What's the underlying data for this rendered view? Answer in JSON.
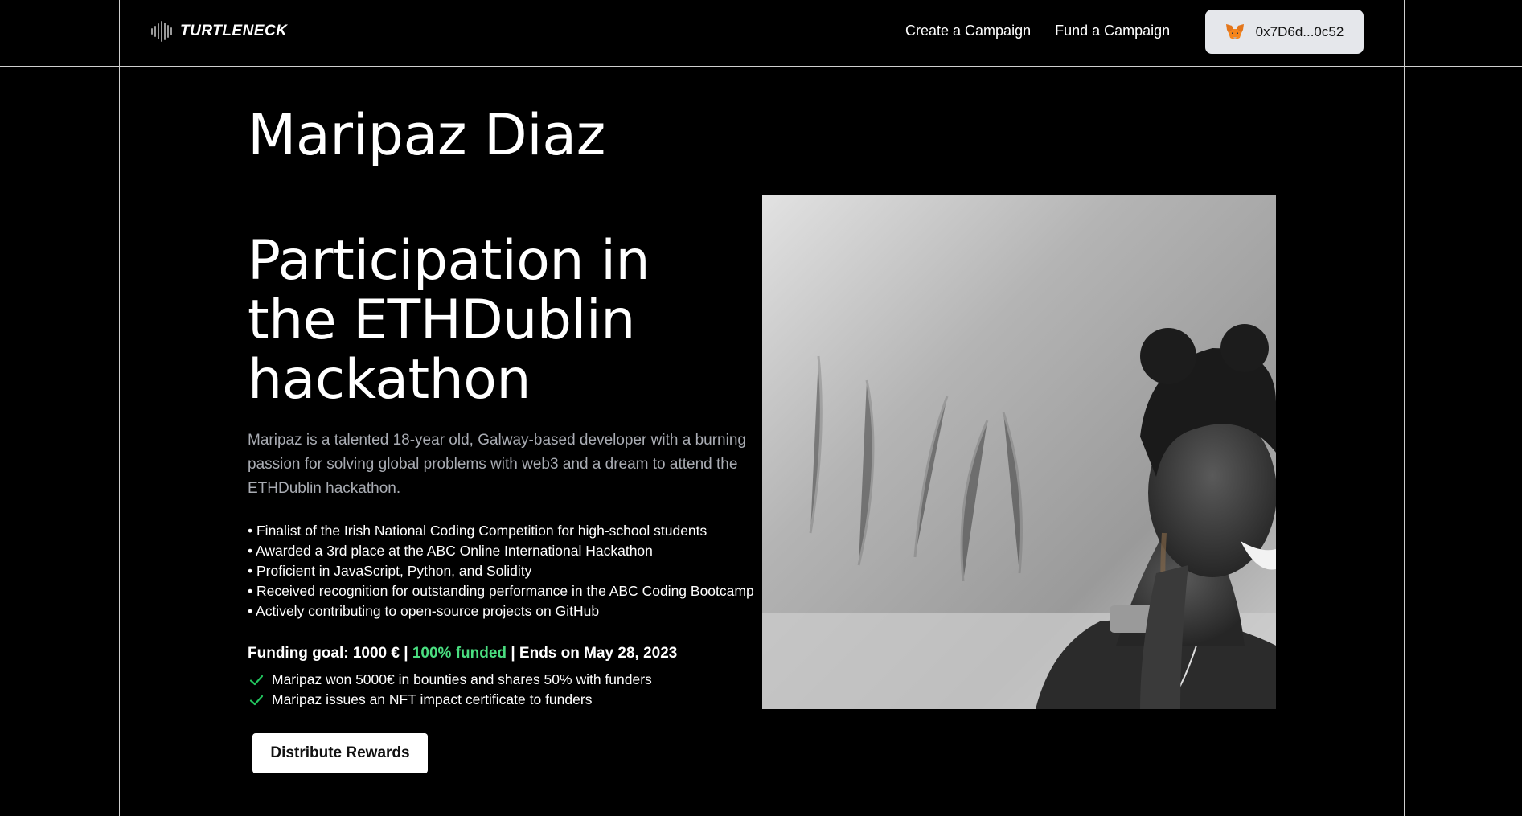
{
  "header": {
    "brand": "TURTLENECK",
    "nav": [
      "Create a Campaign",
      "Fund a Campaign"
    ],
    "wallet_address": "0x7D6d...0c52"
  },
  "campaign": {
    "name": "Maripaz Diaz",
    "title": "Participation in the ETHDublin hackathon",
    "description": "Maripaz is a talented 18-year old, Galway-based developer with a burning passion for solving global problems with web3 and a dream to attend the ETHDublin hackathon.",
    "achievements": [
      "• Finalist of the Irish National Coding Competition for high-school students",
      "• Awarded a 3rd place at the ABC Online International Hackathon",
      "• Proficient in JavaScript, Python, and Solidity",
      "• Received recognition for outstanding performance in the ABC Coding Bootcamp"
    ],
    "achievement_last_prefix": "• Actively contributing to open-source projects on ",
    "achievement_last_link": "GitHub",
    "funding": {
      "goal": "Funding goal: 1000 € | ",
      "funded": "100% funded",
      "ends": " | Ends on May 28, 2023",
      "funded_color": "#4ade80"
    },
    "benefits": [
      "Maripaz won 5000€ in bounties and shares 50% with funders",
      "Maripaz issues an NFT impact certificate to funders"
    ],
    "action_label": "Distribute Rewards"
  },
  "icons": {
    "brand": "soundwave-icon",
    "wallet": "metamask-fox-icon",
    "benefit": "check-icon"
  }
}
